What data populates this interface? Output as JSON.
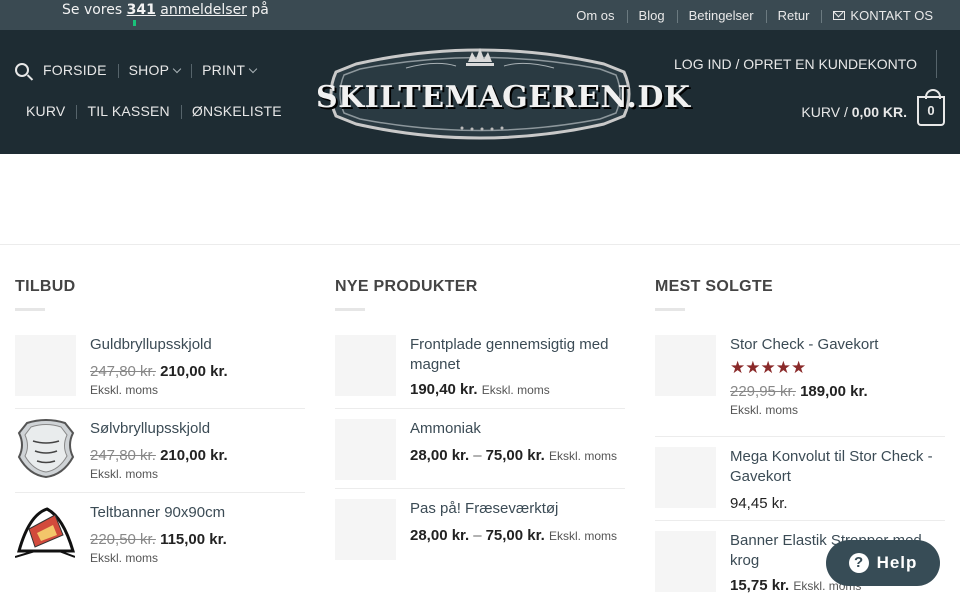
{
  "topbar": {
    "review_prefix": "Se vores",
    "review_count": "341",
    "review_link": "anmeldelser",
    "review_suffix": "på",
    "nav": [
      "Om os",
      "Blog",
      "Betingelser",
      "Retur"
    ],
    "contact": "KONTAKT OS"
  },
  "header": {
    "main_nav": [
      "FORSIDE",
      "SHOP",
      "PRINT"
    ],
    "sub_nav": [
      "KURV",
      "TIL KASSEN",
      "ØNSKELISTE"
    ],
    "logo_text": "SKILTEMAGEREN.DK",
    "login": "LOG IND / OPRET EN KUNDEKONTO",
    "cart_label": "KURV /",
    "cart_total": "0,00 KR.",
    "cart_count": "0"
  },
  "colors": {
    "topbar": "#3a4a52",
    "header": "#1e2c33",
    "star": "#8a2a2a",
    "help": "#374c56"
  },
  "columns": [
    {
      "title": "TILBUD",
      "items": [
        {
          "name": "Guldbryllupsskjold",
          "old": "247,80 kr.",
          "price": "210,00 kr.",
          "note": "Ekskl. moms",
          "thumb": "blank"
        },
        {
          "name": "Sølvbryllupsskjold",
          "old": "247,80 kr.",
          "price": "210,00 kr.",
          "note": "Ekskl. moms",
          "thumb": "shield"
        },
        {
          "name": "Teltbanner 90x90cm",
          "old": "220,50 kr.",
          "price": "115,00 kr.",
          "note": "Ekskl. moms",
          "thumb": "tent"
        }
      ]
    },
    {
      "title": "NYE PRODUKTER",
      "items": [
        {
          "name": "Frontplade gennemsigtig med magnet",
          "price": "190,40 kr.",
          "note": "Ekskl. moms"
        },
        {
          "name": "Ammoniak",
          "price": "28,00 kr.",
          "price_to": "75,00 kr.",
          "note": "Ekskl. moms"
        },
        {
          "name": "Pas på! Fræseværktøj",
          "price": "28,00 kr.",
          "price_to": "75,00 kr.",
          "note": "Ekskl. moms"
        }
      ]
    },
    {
      "title": "MEST SOLGTE",
      "items": [
        {
          "name": "Stor Check - Gavekort",
          "rating": "★★★★★",
          "old": "229,95 kr.",
          "price": "189,00 kr.",
          "note": "Ekskl. moms"
        },
        {
          "name": "Mega Konvolut til Stor Check - Gavekort",
          "plain_price": "94,45 kr."
        },
        {
          "name": "Banner Elastik Stropper med krog",
          "price": "15,75 kr.",
          "note": "Ekskl. moms"
        }
      ]
    }
  ],
  "help": {
    "label": "Help",
    "icon": "?"
  }
}
